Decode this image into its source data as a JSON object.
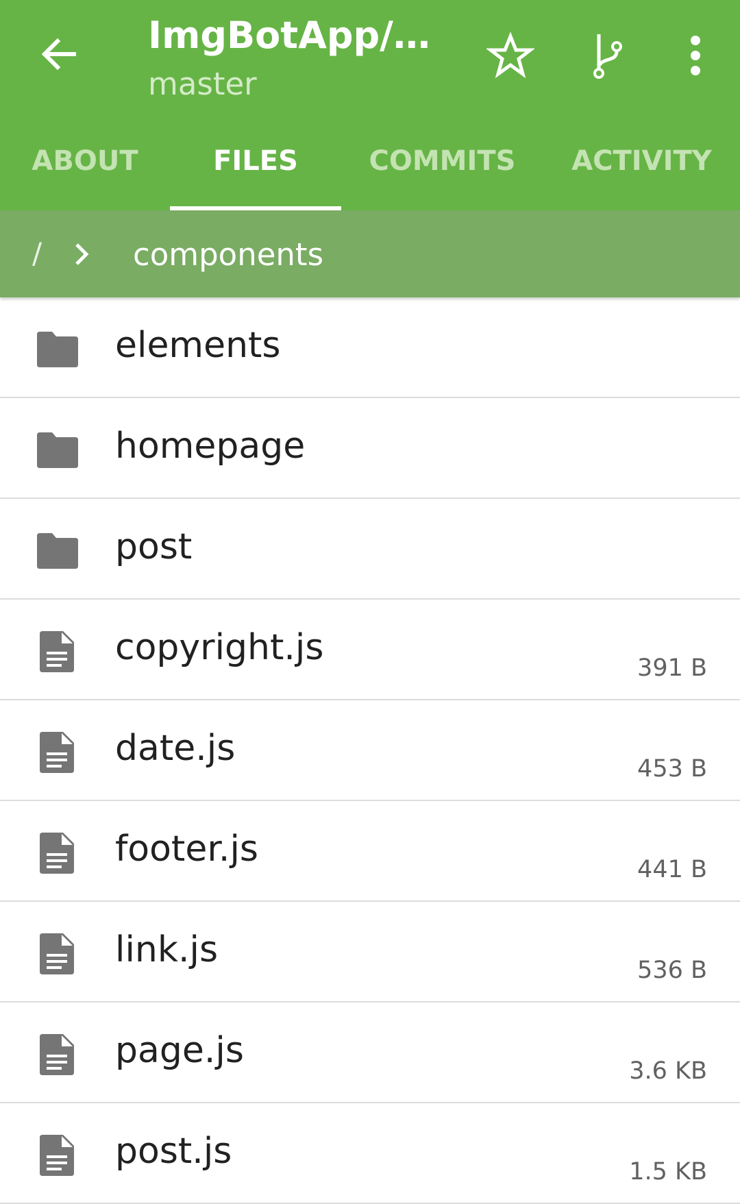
{
  "toolbar": {
    "title": "ImgBotApp/m…",
    "subtitle": "master"
  },
  "tabs": [
    {
      "label": "ABOUT",
      "active": false
    },
    {
      "label": "FILES",
      "active": true
    },
    {
      "label": "COMMITS",
      "active": false
    },
    {
      "label": "ACTIVITY",
      "active": false
    }
  ],
  "breadcrumb": {
    "root": "/",
    "current": "components"
  },
  "files": [
    {
      "name": "elements",
      "type": "folder",
      "size": ""
    },
    {
      "name": "homepage",
      "type": "folder",
      "size": ""
    },
    {
      "name": "post",
      "type": "folder",
      "size": ""
    },
    {
      "name": "copyright.js",
      "type": "file",
      "size": "391 B"
    },
    {
      "name": "date.js",
      "type": "file",
      "size": "453 B"
    },
    {
      "name": "footer.js",
      "type": "file",
      "size": "441 B"
    },
    {
      "name": "link.js",
      "type": "file",
      "size": "536 B"
    },
    {
      "name": "page.js",
      "type": "file",
      "size": "3.6 KB"
    },
    {
      "name": "post.js",
      "type": "file",
      "size": "1.5 KB"
    }
  ],
  "icons": {
    "back": "arrow-back-icon",
    "star": "star-outline-icon",
    "branch": "git-branch-icon",
    "more": "more-vert-icon",
    "folder": "folder-icon",
    "file": "file-document-icon"
  },
  "colors": {
    "appbar": "#66b446",
    "breadcrumb": "#7aac64",
    "icon_gray": "#757575"
  }
}
